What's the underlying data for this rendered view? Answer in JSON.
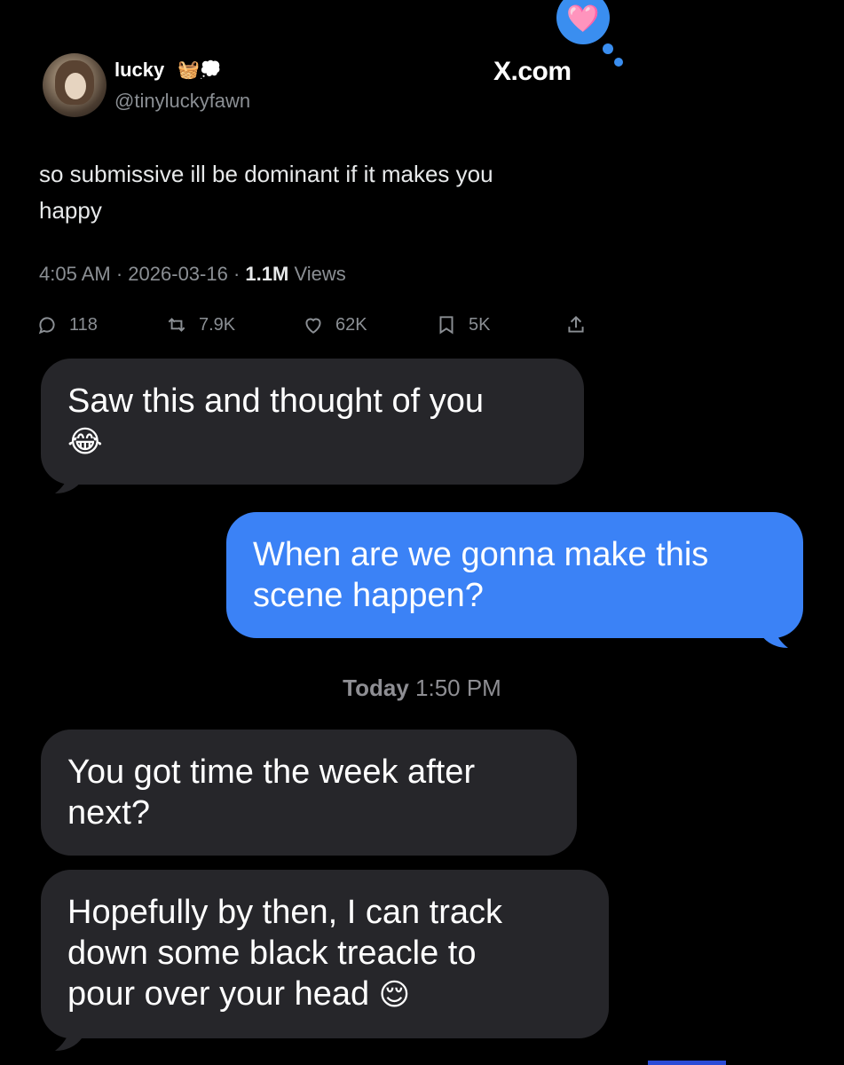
{
  "tweet": {
    "display_name": "lucky",
    "name_icons": "🧺💭",
    "handle": "@tinyluckyfawn",
    "site_label": "X.com",
    "text_line1": "so submissive ill be dominant if it makes you",
    "text_line2": "happy",
    "time": "4:05 AM",
    "date": "2026-03-16",
    "views_count": "1.1M",
    "views_label": "Views",
    "separator": "·",
    "replies": "118",
    "reposts": "7.9K",
    "likes": "62K",
    "bookmarks": "5K",
    "heart_emoji": "🩷"
  },
  "messages": [
    {
      "direction": "incoming",
      "line1": "Saw this and thought of you",
      "emoji": "😂"
    },
    {
      "direction": "outgoing",
      "line1": "When are we gonna make this",
      "line2": "scene happen?"
    },
    {
      "direction": "incoming",
      "line1": "You got time the week after",
      "line2": "next?"
    },
    {
      "direction": "incoming",
      "line1": "Hopefully by then, I can track",
      "line2": "down some black treacle to",
      "line3": "pour over your head",
      "emoji": "😌"
    }
  ],
  "timestamp": {
    "day": "Today",
    "time": "1:50 PM"
  },
  "colors": {
    "outgoing_bubble": "#3b82f6",
    "incoming_bubble": "#26262a",
    "background": "#000000",
    "thought_bubble": "#3a8ef0"
  }
}
